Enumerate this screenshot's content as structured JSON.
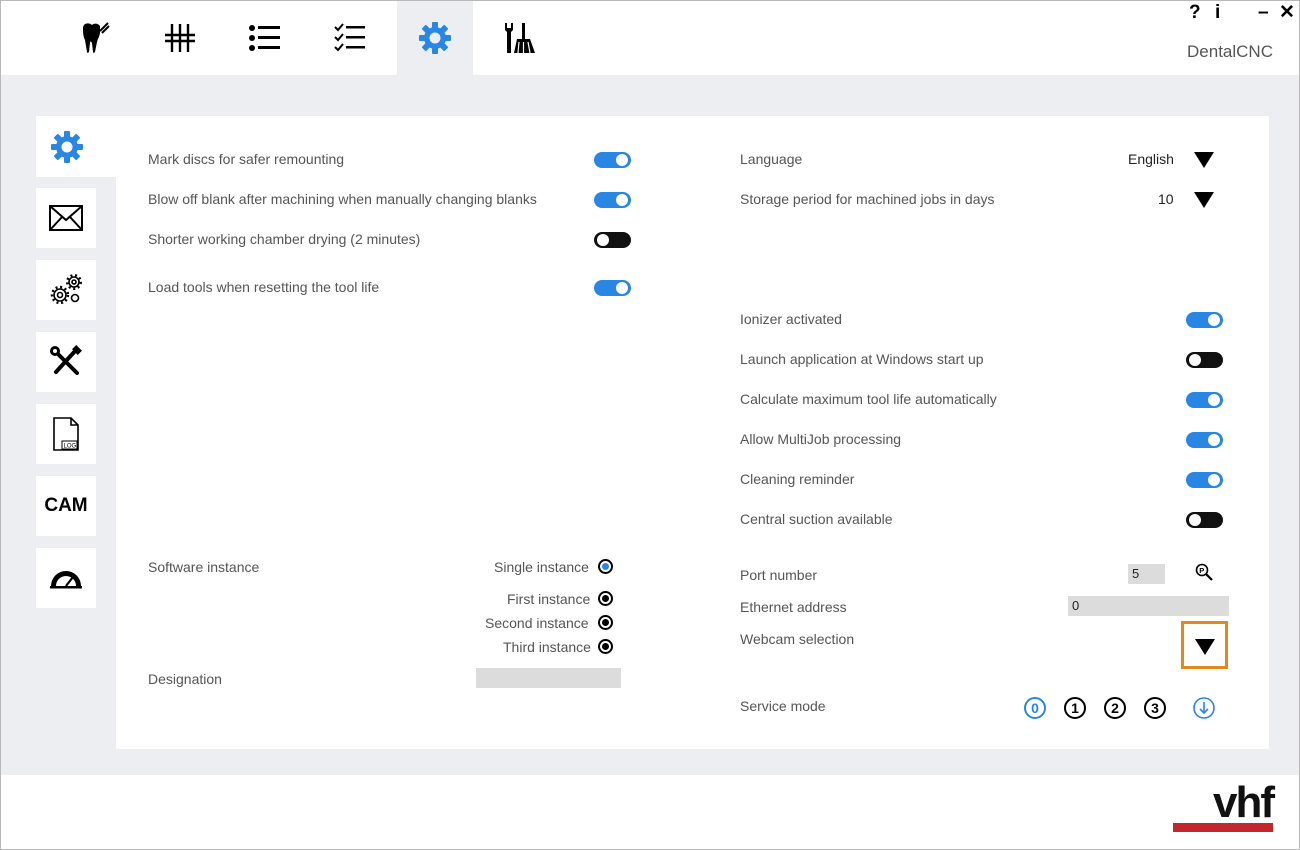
{
  "app": {
    "title": "DentalCNC",
    "help_label": "?",
    "info_label": "i",
    "minimize_label": "–",
    "close_label": "✕"
  },
  "top_tabs": [
    {
      "icon": "tooth-icon"
    },
    {
      "icon": "sliders-icon"
    },
    {
      "icon": "list-icon"
    },
    {
      "icon": "checklist-icon"
    },
    {
      "icon": "gear-icon",
      "active": true
    },
    {
      "icon": "tools-broom-icon"
    }
  ],
  "side_menu": [
    {
      "icon": "gear-icon",
      "active": true
    },
    {
      "icon": "mail-icon"
    },
    {
      "icon": "gears-icon"
    },
    {
      "icon": "wrench-screwdriver-icon"
    },
    {
      "icon": "log-file-icon",
      "text": "LOG"
    },
    {
      "icon": "cam-icon",
      "text": "CAM"
    },
    {
      "icon": "gauge-icon"
    }
  ],
  "left_settings": [
    {
      "label": "Mark discs for safer remounting",
      "on": true
    },
    {
      "label": "Blow off blank after machining when manually changing blanks",
      "on": true
    },
    {
      "label": "Shorter working chamber drying (2 minutes)",
      "on": false
    },
    {
      "label": "Load tools when resetting the tool life",
      "on": true
    }
  ],
  "language": {
    "label": "Language",
    "value": "English"
  },
  "storage": {
    "label": "Storage period for machined jobs in days",
    "value": "10"
  },
  "right_settings": [
    {
      "label": "Ionizer activated",
      "on": true
    },
    {
      "label": "Launch application at Windows start up",
      "on": false
    },
    {
      "label": "Calculate maximum tool life automatically",
      "on": true
    },
    {
      "label": "Allow MultiJob processing",
      "on": true
    },
    {
      "label": "Cleaning reminder",
      "on": true
    },
    {
      "label": "Central suction available",
      "on": false
    }
  ],
  "software_instance": {
    "label": "Software instance",
    "options": [
      "Single instance",
      "First instance",
      "Second instance",
      "Third instance"
    ],
    "selected": "Single instance"
  },
  "designation": {
    "label": "Designation",
    "value": ""
  },
  "port": {
    "label": "Port number",
    "value": "5"
  },
  "ethernet": {
    "label": "Ethernet address",
    "value": "0"
  },
  "webcam": {
    "label": "Webcam selection"
  },
  "service_mode": {
    "label": "Service mode",
    "levels": [
      "0",
      "1",
      "2",
      "3"
    ],
    "selected": "0"
  },
  "brand": {
    "logo_text": "vhf",
    "accent": "#c4262e"
  },
  "colors": {
    "accent": "#2a86e3",
    "highlight": "#e08a1e"
  }
}
